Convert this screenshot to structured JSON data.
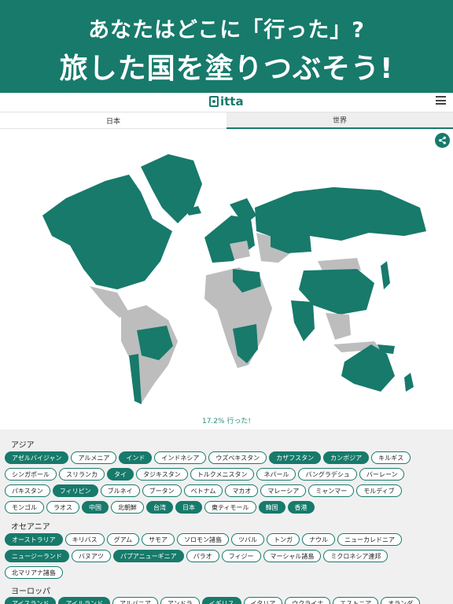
{
  "promo": {
    "line1": "あなたはどこに「行った」?",
    "line2": "旅した国を塗りつぶそう!"
  },
  "app": {
    "logo_text": "itta"
  },
  "tabs": [
    {
      "label": "日本",
      "selected": false
    },
    {
      "label": "世界",
      "selected": true
    }
  ],
  "map": {
    "visited_color": "#177a6b",
    "unvisited_color": "#bdbdbd"
  },
  "progress": {
    "label": "17.2% 行った!",
    "percent": 17.2
  },
  "regions": [
    {
      "title": "アジア",
      "rows": [
        [
          {
            "name": "アゼルバイジャン",
            "visited": true
          },
          {
            "name": "アルメニア",
            "visited": false
          },
          {
            "name": "インド",
            "visited": true
          },
          {
            "name": "インドネシア",
            "visited": false
          },
          {
            "name": "ウズベキスタン",
            "visited": false
          },
          {
            "name": "カザフスタン",
            "visited": true
          },
          {
            "name": "カンボジア",
            "visited": true
          },
          {
            "name": "キルギス",
            "visited": false
          }
        ],
        [
          {
            "name": "シンガポール",
            "visited": false
          },
          {
            "name": "スリランカ",
            "visited": false
          },
          {
            "name": "タイ",
            "visited": true
          },
          {
            "name": "タジキスタン",
            "visited": false
          },
          {
            "name": "トルクメニスタン",
            "visited": false
          },
          {
            "name": "ネパール",
            "visited": false
          },
          {
            "name": "バングラデシュ",
            "visited": false
          },
          {
            "name": "バーレーン",
            "visited": false
          }
        ],
        [
          {
            "name": "パキスタン",
            "visited": false
          },
          {
            "name": "フィリピン",
            "visited": true
          },
          {
            "name": "ブルネイ",
            "visited": false
          },
          {
            "name": "ブータン",
            "visited": false
          },
          {
            "name": "ベトナム",
            "visited": false
          },
          {
            "name": "マカオ",
            "visited": false
          },
          {
            "name": "マレーシア",
            "visited": false
          },
          {
            "name": "ミャンマー",
            "visited": false
          },
          {
            "name": "モルディブ",
            "visited": false
          }
        ],
        [
          {
            "name": "モンゴル",
            "visited": false
          },
          {
            "name": "ラオス",
            "visited": false
          },
          {
            "name": "中国",
            "visited": true
          },
          {
            "name": "北朝鮮",
            "visited": false
          },
          {
            "name": "台湾",
            "visited": true
          },
          {
            "name": "日本",
            "visited": true
          },
          {
            "name": "東ティモール",
            "visited": false
          },
          {
            "name": "韓国",
            "visited": true
          },
          {
            "name": "香港",
            "visited": true
          }
        ]
      ]
    },
    {
      "title": "オセアニア",
      "rows": [
        [
          {
            "name": "オーストラリア",
            "visited": true
          },
          {
            "name": "キリバス",
            "visited": false
          },
          {
            "name": "グアム",
            "visited": false
          },
          {
            "name": "サモア",
            "visited": false
          },
          {
            "name": "ソロモン諸島",
            "visited": false
          },
          {
            "name": "ツバル",
            "visited": false
          },
          {
            "name": "トンガ",
            "visited": false
          },
          {
            "name": "ナウル",
            "visited": false
          },
          {
            "name": "ニューカレドニア",
            "visited": false
          }
        ],
        [
          {
            "name": "ニュージーランド",
            "visited": true
          },
          {
            "name": "バヌアツ",
            "visited": false
          },
          {
            "name": "パプアニューギニア",
            "visited": true
          },
          {
            "name": "パラオ",
            "visited": false
          },
          {
            "name": "フィジー",
            "visited": false
          },
          {
            "name": "マーシャル諸島",
            "visited": false
          },
          {
            "name": "ミクロネシア連邦",
            "visited": false
          }
        ],
        [
          {
            "name": "北マリアナ諸島",
            "visited": false
          }
        ]
      ]
    },
    {
      "title": "ヨーロッパ",
      "rows": [
        [
          {
            "name": "アイスランド",
            "visited": true
          },
          {
            "name": "アイルランド",
            "visited": true
          },
          {
            "name": "アルバニア",
            "visited": false
          },
          {
            "name": "アンドラ",
            "visited": false
          },
          {
            "name": "イギリス",
            "visited": true
          },
          {
            "name": "イタリア",
            "visited": false
          },
          {
            "name": "ウクライナ",
            "visited": false
          },
          {
            "name": "エストニア",
            "visited": false
          },
          {
            "name": "オランダ",
            "visited": false
          }
        ]
      ]
    }
  ]
}
